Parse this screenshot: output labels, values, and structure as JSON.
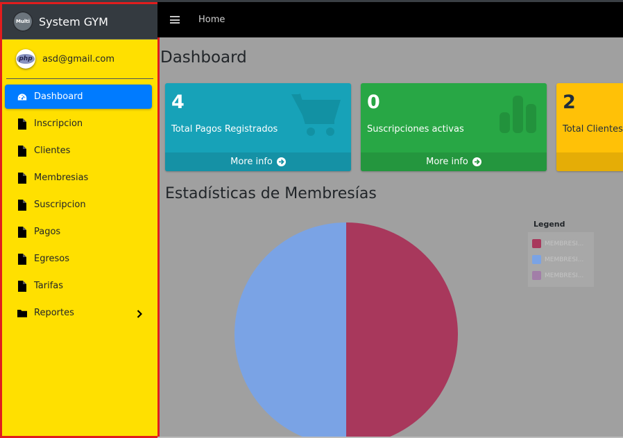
{
  "brand": {
    "title": "System GYM",
    "logo_text": "Multi"
  },
  "user": {
    "email": "asd@gmail.com",
    "avatar_text": "php"
  },
  "sidebar": {
    "items": [
      {
        "label": "Dashboard",
        "icon": "dashboard-icon",
        "active": true
      },
      {
        "label": "Inscripcion",
        "icon": "file-icon"
      },
      {
        "label": "Clientes",
        "icon": "file-icon"
      },
      {
        "label": "Membresias",
        "icon": "file-icon"
      },
      {
        "label": "Suscripcion",
        "icon": "file-icon"
      },
      {
        "label": "Pagos",
        "icon": "file-icon"
      },
      {
        "label": "Egresos",
        "icon": "file-icon"
      },
      {
        "label": "Tarifas",
        "icon": "file-icon"
      },
      {
        "label": "Reportes",
        "icon": "folder-icon",
        "has_submenu": true
      }
    ]
  },
  "navbar": {
    "home_label": "Home"
  },
  "page": {
    "title": "Dashboard",
    "section_title": "Estadísticas de Membresías"
  },
  "stats": [
    {
      "number": "4",
      "label": "Total Pagos Registrados",
      "footer": "More info",
      "icon": "shopping-cart-icon",
      "color": "#17a2b8"
    },
    {
      "number": "0",
      "label": "Suscripciones activas",
      "footer": "More info",
      "icon": "bar-chart-icon",
      "color": "#28a745"
    },
    {
      "number": "2",
      "label": "Total Clientes",
      "footer": "",
      "icon": "",
      "color": "#ffc107"
    }
  ],
  "chart_data": {
    "type": "pie",
    "title": "Estadísticas de Membresías",
    "legend_title": "Legend",
    "legend_position": "top-right",
    "labels": [
      "MEMBRESI...",
      "MEMBRESI...",
      "MEMBRESI..."
    ],
    "values": [
      50,
      50,
      0
    ],
    "colors": [
      "#a8385c",
      "#7aa3e5",
      "#a27ea8"
    ]
  }
}
